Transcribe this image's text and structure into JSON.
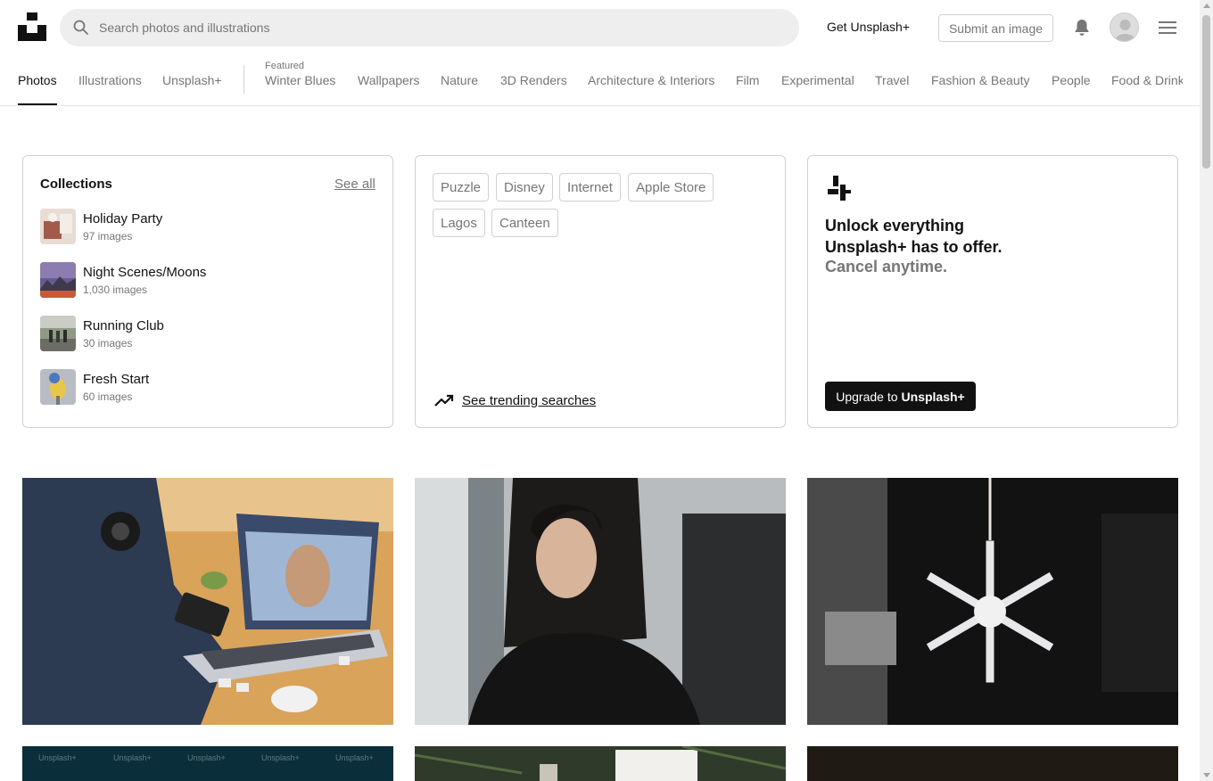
{
  "header": {
    "search_placeholder": "Search photos and illustrations",
    "get_plus_label": "Get Unsplash+",
    "submit_label": "Submit an image"
  },
  "nav": {
    "primary": [
      "Photos",
      "Illustrations",
      "Unsplash+"
    ],
    "featured_label": "Featured",
    "topics": [
      "Winter Blues",
      "Wallpapers",
      "Nature",
      "3D Renders",
      "Architecture & Interiors",
      "Film",
      "Experimental",
      "Travel",
      "Fashion & Beauty",
      "People",
      "Food & Drink"
    ]
  },
  "collections": {
    "title": "Collections",
    "see_all": "See all",
    "items": [
      {
        "name": "Holiday Party",
        "count": "97 images"
      },
      {
        "name": "Night Scenes/Moons",
        "count": "1,030 images"
      },
      {
        "name": "Running Club",
        "count": "30 images"
      },
      {
        "name": "Fresh Start",
        "count": "60 images"
      }
    ]
  },
  "searches": {
    "tags": [
      "Puzzle",
      "Disney",
      "Internet",
      "Apple Store",
      "Lagos",
      "Canteen"
    ],
    "trending_label": "See trending searches"
  },
  "promo": {
    "line1": "Unlock everything",
    "line2": "Unsplash+ has to offer.",
    "line3": "Cancel anytime.",
    "upgrade_prefix": "Upgrade to",
    "upgrade_brand": "Unsplash+"
  },
  "photos": {
    "watermark": "Unsplash+"
  },
  "colors": {
    "text": "#111111",
    "muted": "#767676",
    "border": "#d1d1d1",
    "search_bg": "#eeeeee"
  }
}
